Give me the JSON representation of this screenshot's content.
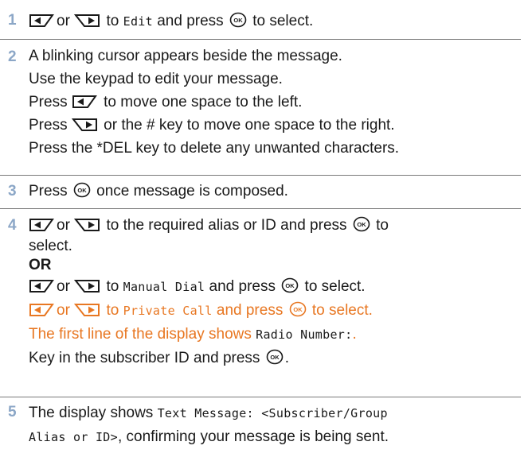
{
  "colors": {
    "step_number": "#8ca7c7",
    "highlight": "#e87722",
    "text": "#1a1a1a",
    "rule": "#7a7a7a"
  },
  "icons": {
    "left": "left-arrow-button-icon",
    "right": "right-arrow-button-icon",
    "ok": "ok-button-icon"
  },
  "steps": [
    {
      "number": "1",
      "or": "or",
      "to": "to",
      "target": "Edit",
      "and_press": "and press",
      "to_select": "to select."
    },
    {
      "number": "2",
      "line1": "A blinking cursor appears beside the message.",
      "line2": "Use the keypad to edit your message.",
      "press": "Press",
      "line3_rest": "to move one space to the left.",
      "line4_rest": "or the # key to move one space to the right.",
      "line5": "Press the *DEL key to delete any unwanted characters."
    },
    {
      "number": "3",
      "press": "Press",
      "rest": "once message is composed."
    },
    {
      "number": "4",
      "or": "or",
      "a_text": "to the required alias or ID and press",
      "a_to": "to",
      "a_select": "select.",
      "or_label": "OR",
      "to": "to",
      "manual_target": "Manual Dial",
      "and_press": "and press",
      "to_select": "to select.",
      "private_target": "Private Call",
      "display_line": "The first line of the display shows",
      "radio_number": "Radio Number:",
      "period": ".",
      "key_in": "Key in the subscriber ID and press",
      "final_period": "."
    },
    {
      "number": "5",
      "display_shows": "The display shows",
      "message_part1": "Text Message: <Subscriber/Group",
      "message_part2": "Alias or ID>",
      "rest": ", confirming your message is being sent."
    }
  ]
}
